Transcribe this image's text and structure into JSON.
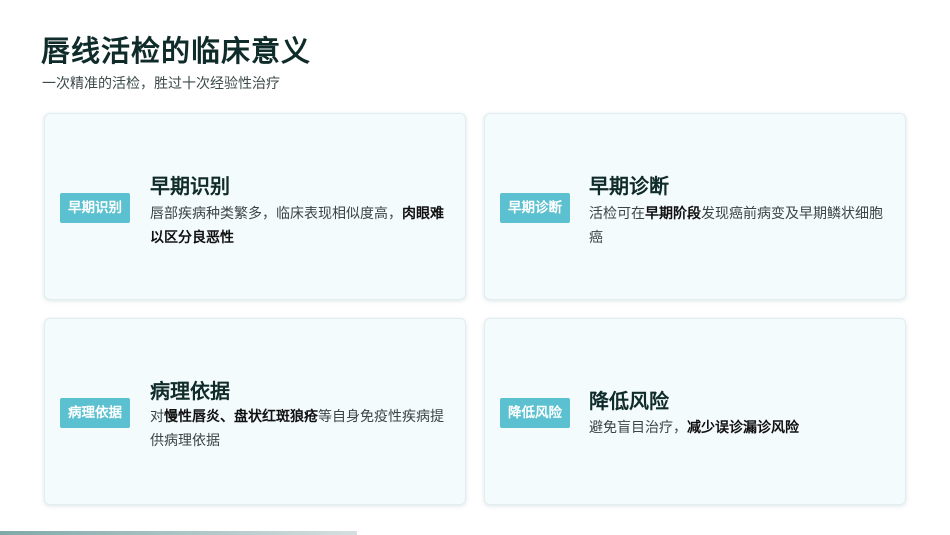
{
  "header": {
    "title": "唇线活检的临床意义",
    "subtitle": "一次精准的活检，胜过十次经验性治疗"
  },
  "cards": [
    {
      "tag": "早期识别",
      "title": "早期识别",
      "desc": [
        {
          "text": "唇部疾病种类繁多，临床表现相似度高，",
          "bold": false
        },
        {
          "text": "肉眼难以区分良恶性",
          "bold": true
        }
      ]
    },
    {
      "tag": "早期诊断",
      "title": "早期诊断",
      "desc": [
        {
          "text": "活检可在",
          "bold": false
        },
        {
          "text": "早期阶段",
          "bold": true
        },
        {
          "text": "发现癌前病变及早期鳞状细胞癌",
          "bold": false
        }
      ]
    },
    {
      "tag": "病理依据",
      "title": "病理依据",
      "desc": [
        {
          "text": "对",
          "bold": false
        },
        {
          "text": "慢性唇炎、盘状红斑狼疮",
          "bold": true
        },
        {
          "text": "等自身免疫性疾病提供病理依据",
          "bold": false
        }
      ]
    },
    {
      "tag": "降低风险",
      "title": "降低风险",
      "desc": [
        {
          "text": "避免盲目治疗，",
          "bold": false
        },
        {
          "text": "减少误诊漏诊风险",
          "bold": true
        }
      ]
    }
  ],
  "colors": {
    "accent": "#5bc0cf",
    "card_bg": "#f4fbfd",
    "title": "#0f2b2a"
  }
}
